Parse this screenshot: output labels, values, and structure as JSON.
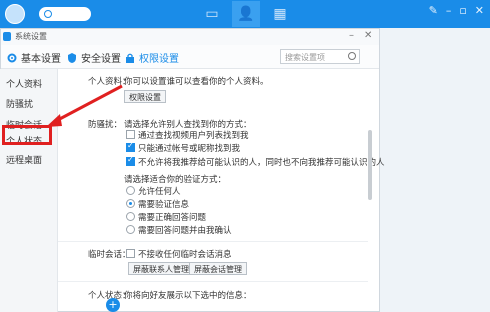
{
  "app": {
    "top_icons": [
      "chat-icon",
      "contacts-icon",
      "apps-icon"
    ]
  },
  "dialog": {
    "title": "系统设置",
    "tabs": [
      {
        "label": "基本设置",
        "icon": "gear-icon"
      },
      {
        "label": "安全设置",
        "icon": "shield-icon"
      },
      {
        "label": "权限设置",
        "icon": "lock-icon",
        "active": true
      }
    ],
    "search_placeholder": "搜索设置项"
  },
  "sidebar": {
    "items": [
      "个人资料",
      "防骚扰",
      "临时会话",
      "个人状态",
      "远程桌面"
    ],
    "highlighted": "个人状态"
  },
  "sections": {
    "profile": {
      "label": "个人资料：",
      "desc": "你可以设置谁可以查看你的个人资料。",
      "button": "权限设置"
    },
    "anti_harass": {
      "label": "防骚扰：",
      "find_title": "请选择允许别人查找到你的方式：",
      "options": [
        {
          "text": "通过查找视频用户列表找到我",
          "checked": false
        },
        {
          "text": "只能通过帐号或昵称找到我",
          "checked": true
        },
        {
          "text": "不允许将我推荐给可能认识的人，同时也不向我推荐可能认识的人",
          "checked": true
        }
      ],
      "verify_title": "请选择适合你的验证方式：",
      "verify": [
        {
          "text": "允许任何人",
          "selected": false
        },
        {
          "text": "需要验证信息",
          "selected": true
        },
        {
          "text": "需要正确回答问题",
          "selected": false
        },
        {
          "text": "需要回答问题并由我确认",
          "selected": false
        }
      ]
    },
    "temp_chat": {
      "label": "临时会话：",
      "option": "不接收任何临时会话消息",
      "btn1": "屏蔽联系人管理",
      "btn2": "屏蔽会话管理"
    },
    "status": {
      "label": "个人状态：",
      "desc": "你将向好友展示以下选中的信息："
    }
  },
  "colors": {
    "accent": "#1a8ce8",
    "highlight": "#e02020"
  }
}
